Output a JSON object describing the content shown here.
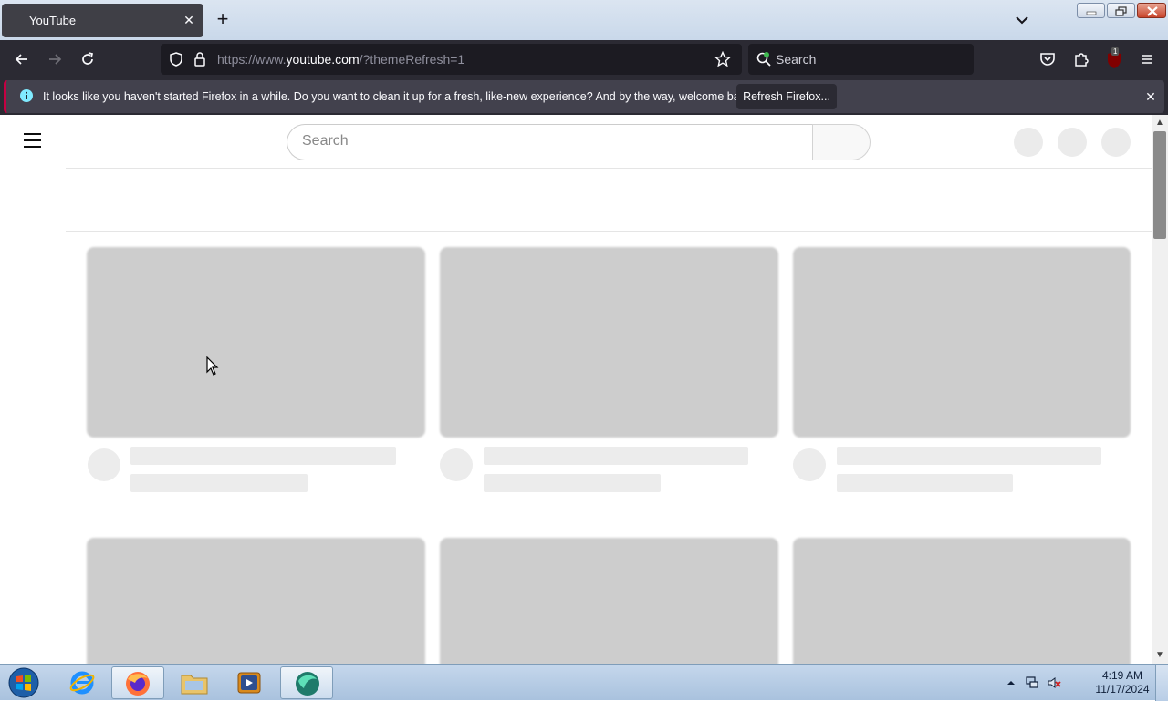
{
  "browser": {
    "tab_title": "YouTube",
    "tab_close": "✕",
    "new_tab": "+",
    "url_prefix": "https://www.",
    "url_host": "youtube.com",
    "url_path": "/?themeRefresh=1",
    "search_placeholder": "Search",
    "extension_badge": "1"
  },
  "notification": {
    "message": "It looks like you haven't started Firefox in a while. Do you want to clean it up for a fresh, like-new experience? And by the way, welcome back!",
    "button_label": "Refresh Firefox...",
    "close": "✕"
  },
  "youtube": {
    "search_placeholder": "Search",
    "video_skeleton_count": 6
  },
  "taskbar": {
    "time": "4:19 AM",
    "date": "11/17/2024",
    "apps": [
      "start-orb",
      "internet-explorer",
      "firefox",
      "file-explorer",
      "media-player",
      "app-green"
    ]
  },
  "colors": {
    "firefox_toolbar": "#2b2a33",
    "urlbar": "#1c1b22",
    "notif_accent": "#c50042",
    "skeleton_thumb": "#cdcdcd",
    "skeleton_line": "#ececec"
  }
}
